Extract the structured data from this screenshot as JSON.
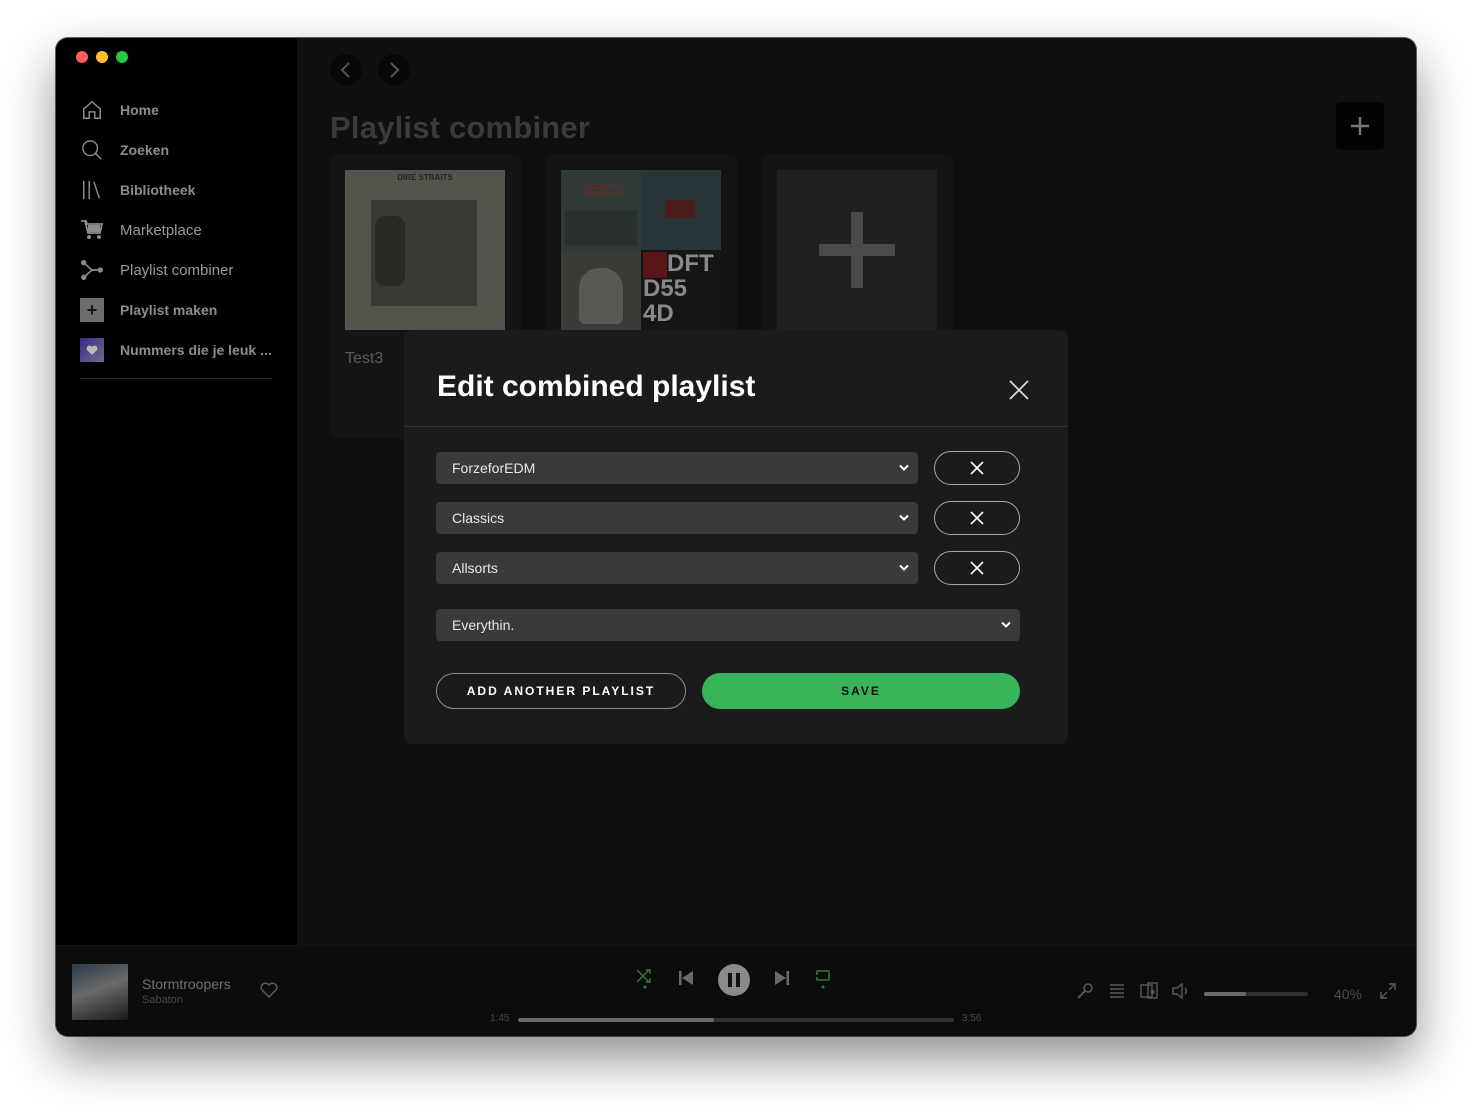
{
  "sidebar": {
    "items": [
      {
        "label": "Home",
        "icon": "home-icon"
      },
      {
        "label": "Zoeken",
        "icon": "search-icon"
      },
      {
        "label": "Bibliotheek",
        "icon": "library-icon"
      },
      {
        "label": "Marketplace",
        "icon": "cart-icon"
      },
      {
        "label": "Playlist combiner",
        "icon": "combine-icon"
      },
      {
        "label": "Playlist maken",
        "icon": "plus-square-icon"
      },
      {
        "label": "Nummers die je leuk ...",
        "icon": "liked-songs-icon"
      }
    ]
  },
  "main": {
    "title": "Playlist combiner",
    "cards": [
      {
        "name": "Test3",
        "cover_text": "DIRE STRAITS"
      },
      {
        "name": "",
        "cover_text": [
          "BADMUTS VERPLICHT",
          "DFT",
          "D55",
          "4D"
        ]
      },
      {
        "name": ""
      }
    ]
  },
  "modal": {
    "title": "Edit combined playlist",
    "playlists": [
      "ForzeforEDM",
      "Classics",
      "Allsorts"
    ],
    "target": "Everythin.",
    "add_label": "ADD ANOTHER PLAYLIST",
    "save_label": "SAVE"
  },
  "player": {
    "track": "Stormtroopers",
    "artist": "Sabaton",
    "elapsed": "1:45",
    "duration": "3:56",
    "progress_fraction": 0.45,
    "volume": "40%",
    "volume_fraction": 0.4
  },
  "colors": {
    "accent": "#3ab45a",
    "background": "#0f0f0f",
    "modal": "#1b1b1b"
  }
}
